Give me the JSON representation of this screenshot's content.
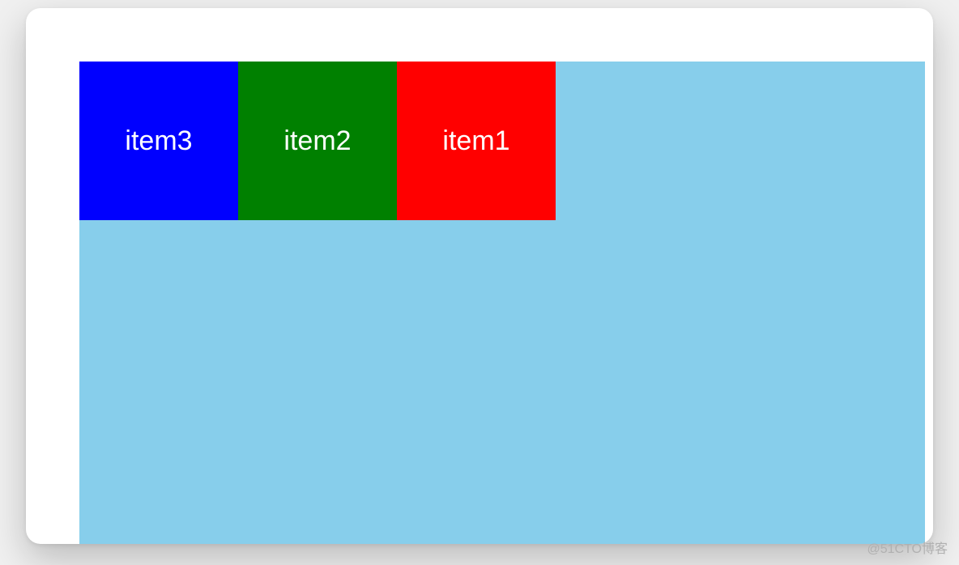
{
  "container": {
    "background": "#87CEEB",
    "flex_direction": "row-reverse"
  },
  "items": [
    {
      "label": "item1",
      "color": "#FF0000",
      "name": "red"
    },
    {
      "label": "item2",
      "color": "#008000",
      "name": "green"
    },
    {
      "label": "item3",
      "color": "#0000FF",
      "name": "blue"
    }
  ],
  "watermark": "@51CTO博客"
}
